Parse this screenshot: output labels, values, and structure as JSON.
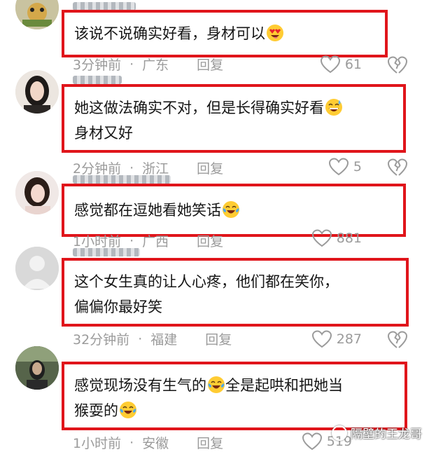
{
  "comments": [
    {
      "text": "该说不说确实好看，身材可以",
      "emoji": "heart-eyes-emoji",
      "time": "3分钟前",
      "location": "广东",
      "reply_label": "回复",
      "likes": "61"
    },
    {
      "line1": "她这做法确实不对，但是长得确实好看",
      "line2": "身材又好",
      "emoji": "sweat-smile-emoji",
      "time": "2分钟前",
      "location": "浙江",
      "reply_label": "回复",
      "likes": "5"
    },
    {
      "text": "感觉都在逗她看她笑话",
      "emoji": "tears-of-joy-emoji",
      "time": "1小时前",
      "location": "广西",
      "reply_label": "回复",
      "likes": "881"
    },
    {
      "line1": "这个女生真的让人心疼，他们都在笑你，",
      "line2": "偏偏你最好笑",
      "time": "32分钟前",
      "location": "福建",
      "reply_label": "回复",
      "likes": "287"
    },
    {
      "line1_a": "感觉现场没有生气的",
      "line1_b": "全是起哄和把她当",
      "line2": "猴耍的",
      "emoji": "tears-of-joy-emoji",
      "time": "1小时前",
      "location": "安徽",
      "reply_label": "回复",
      "likes": "519"
    }
  ],
  "separator": "·",
  "watermark": "隔壁的王龙哥",
  "colors": {
    "highlight_border": "#e0151b",
    "meta_text": "#9b9b9b"
  }
}
